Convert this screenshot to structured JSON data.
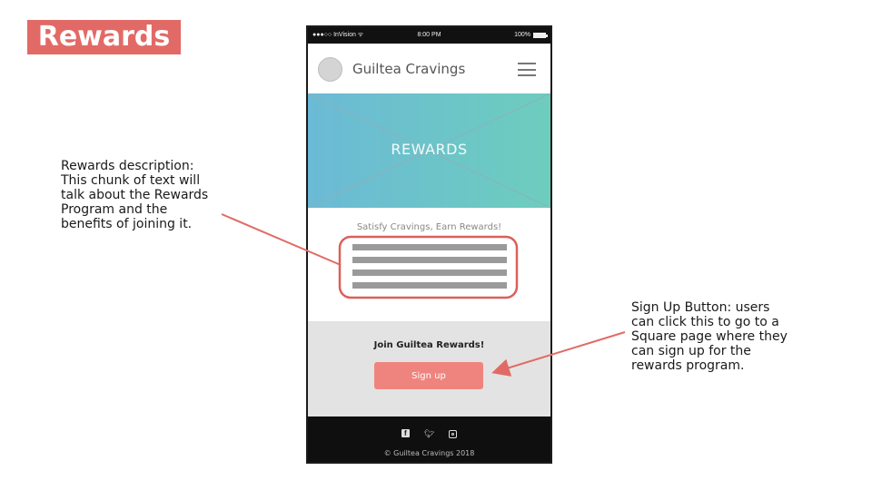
{
  "slide": {
    "title": "Rewards",
    "annotation_description": "Rewards description:\nThis chunk of text will\ntalk about the Rewards\nProgram and the\nbenefits of joining it.",
    "annotation_signup": "Sign Up Button: users\ncan click this to go to a\nSquare page where they\ncan sign up for the\nrewards program.",
    "accent_color": "#e26a66"
  },
  "phone": {
    "status": {
      "carrier": "●●●○○ InVision ᯤ",
      "time": "8:00 PM",
      "battery": "100%"
    },
    "navbar": {
      "brand": "Guiltea Cravings",
      "menu_icon": "hamburger-menu-icon"
    },
    "hero": {
      "label": "REWARDS"
    },
    "description": {
      "heading": "Satisfy Cravings, Earn Rewards!",
      "placeholder_lines": 4
    },
    "join": {
      "title": "Join Guiltea Rewards!",
      "button_label": "Sign up",
      "button_color": "#ef847e"
    },
    "footer": {
      "social_icons": [
        "facebook-icon",
        "twitter-icon",
        "instagram-icon"
      ],
      "copyright": "© Guiltea Cravings 2018"
    }
  }
}
